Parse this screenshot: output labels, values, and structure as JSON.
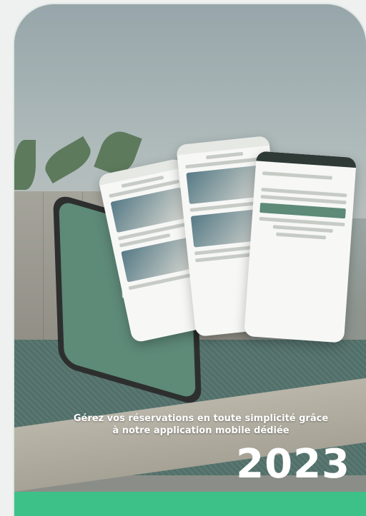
{
  "caption_line1": "Gérez vos réservations en toute simplicité grâce",
  "caption_line2": "à notre application mobile dédiée",
  "year": "2023",
  "colors": {
    "footer": "#3ec089",
    "phone_screen": "#5e8a78",
    "caption_text": "#ffffff"
  },
  "icons": [
    "home-logo-icon"
  ]
}
